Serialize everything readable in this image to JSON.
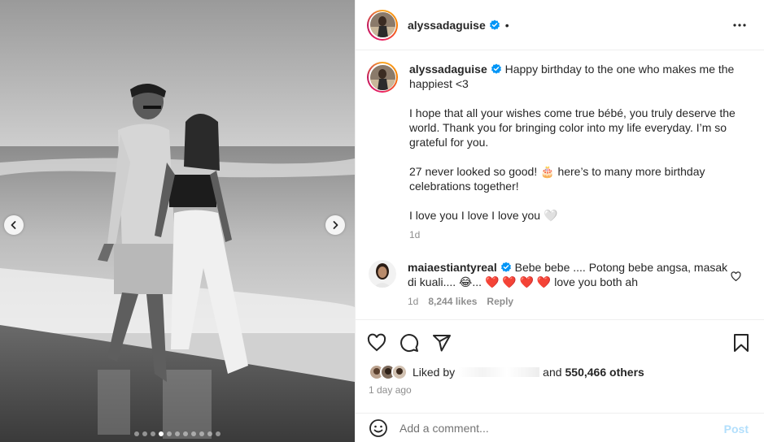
{
  "post": {
    "author": "alyssadaguise",
    "header_bullet": "•",
    "caption_lines": [
      "Happy birthday to the one who makes me the happiest <3",
      "I hope that all your wishes come true bébé, you truly deserve the world. Thank you for bringing color into my life everyday. I’m so grateful for you.",
      "27 never looked so good! 🎂 here’s to many more birthday celebrations together!",
      "I love you I love I love you 🤍"
    ],
    "caption_time": "1d"
  },
  "comment": {
    "author": "maiaestiantyreal",
    "text": "Bebe bebe .... Potong bebe angsa, masak di kuali.... 😂... ❤️ ❤️ ❤️ ❤️  love you both ah",
    "time": "1d",
    "likes": "8,244 likes",
    "reply": "Reply"
  },
  "likes": {
    "prefix": "Liked by",
    "connector": "and",
    "count": "550,466 others"
  },
  "posted": "1 day ago",
  "composer": {
    "placeholder": "Add a comment...",
    "post_label": "Post"
  },
  "carousel": {
    "total": 11,
    "current": 4
  },
  "icons": {
    "verified": "verified-badge-icon",
    "more": "more-options-icon",
    "like": "heart-icon",
    "comment": "comment-bubble-icon",
    "share": "paper-plane-icon",
    "save": "bookmark-icon",
    "emoji": "smiley-icon",
    "prev": "chevron-left-icon",
    "next": "chevron-right-icon"
  },
  "colors": {
    "verified": "#0095f6",
    "post_disabled": "#b2dffc",
    "muted": "#8e8e8e"
  }
}
